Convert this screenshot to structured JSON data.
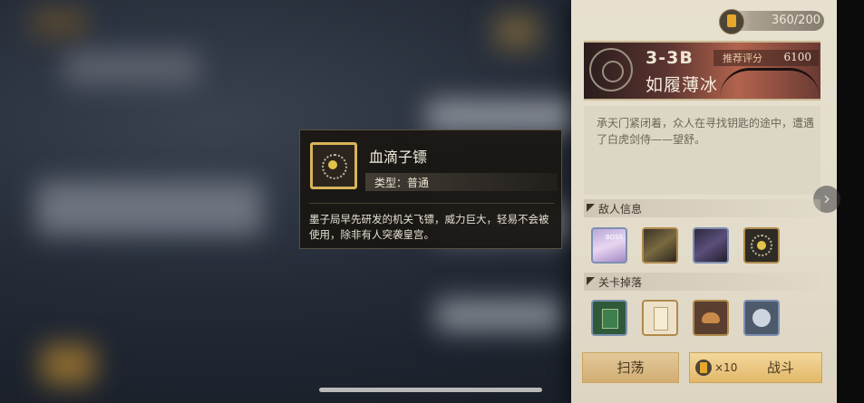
{
  "header": {
    "stamina": "360/200"
  },
  "stage": {
    "code": "3-3B",
    "score_label": "推荐评分",
    "score_value": "6100",
    "name": "如履薄冰",
    "description": "承天门紧闭着，众人在寻找钥匙的途中，遭遇了白虎剑侍——望舒。"
  },
  "enemy_section": {
    "title": "敌人信息",
    "enemies": [
      {
        "icon": "boss-portrait-icon",
        "tag": "BOSS"
      },
      {
        "icon": "gunner-enemy-icon"
      },
      {
        "icon": "purple-warrior-enemy-icon"
      },
      {
        "icon": "shuriken-trap-icon"
      }
    ]
  },
  "drop_section": {
    "title": "关卡掉落",
    "drops": [
      {
        "icon": "green-book-icon"
      },
      {
        "icon": "scroll-paper-icon"
      },
      {
        "icon": "croissant-food-icon"
      },
      {
        "icon": "silver-emblem-icon"
      }
    ]
  },
  "buttons": {
    "sweep": "扫荡",
    "fight": "战斗",
    "fight_cost": "×10"
  },
  "tooltip": {
    "name": "血滴子镖",
    "type": "类型：普通",
    "description": "墨子局早先研发的机关飞镖，威力巨大，轻易不会被使用，除非有人突袭皇宫。"
  },
  "colors": {
    "panel_bg": "#e5dece",
    "accent_gold": "#d9b45a",
    "tooltip_bg": "#1a1612"
  }
}
